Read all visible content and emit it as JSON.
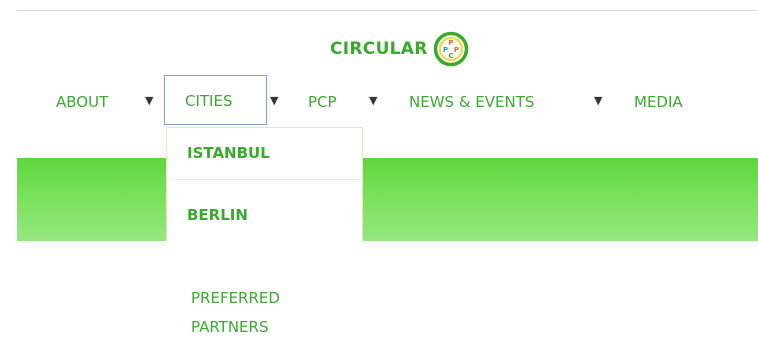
{
  "logo": {
    "text": "CIRCULAR",
    "badge_letters": [
      "P",
      "P",
      "C",
      "P"
    ]
  },
  "nav": {
    "items": [
      {
        "label": "ABOUT",
        "has_caret": true
      },
      {
        "label": "CITIES",
        "has_caret": true,
        "active": true
      },
      {
        "label": "PCP",
        "has_caret": true
      },
      {
        "label": "NEWS & EVENTS",
        "has_caret": true
      },
      {
        "label": "MEDIA",
        "has_caret": false
      }
    ],
    "caret_glyph": "▼"
  },
  "dropdown": {
    "items": [
      {
        "label": "ISTANBUL"
      },
      {
        "label": "BERLIN"
      }
    ]
  },
  "secondary_link": {
    "line1": "PREFERRED",
    "line2": "PARTNERS"
  },
  "colors": {
    "accent_green": "#3aaa2e",
    "band_green": "#5fd63e",
    "caret": "#2f3b2c",
    "active_border": "#7ea2d0"
  }
}
